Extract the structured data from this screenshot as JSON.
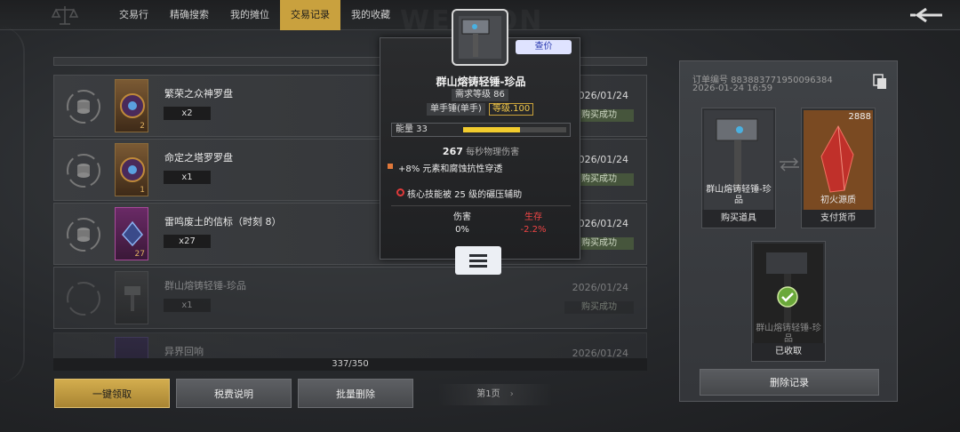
{
  "nav": {
    "tabs": [
      {
        "label": "交易行",
        "active": false
      },
      {
        "label": "精确搜索",
        "active": false
      },
      {
        "label": "我的摊位",
        "active": false
      },
      {
        "label": "交易记录",
        "active": true
      },
      {
        "label": "我的收藏",
        "active": false
      }
    ],
    "watermark": "WEAPON",
    "back_icon": "back-arrow-icon"
  },
  "list": {
    "rows": [
      {
        "name": "繁荣之众神罗盘",
        "qty": "x2",
        "count": "2",
        "date": "2026/01/24",
        "status": "购买成功",
        "thumb_color": "#8a6a3a",
        "icon": "coin-cycle-icon",
        "dim": false
      },
      {
        "name": "命定之塔罗罗盘",
        "qty": "x1",
        "count": "1",
        "date": "2026/01/24",
        "status": "购买成功",
        "thumb_color": "#8a6a3a",
        "icon": "coin-cycle-icon",
        "dim": false
      },
      {
        "name": "雷鸣废土的信标（时刻 8）",
        "qty": "x27",
        "count": "27",
        "date": "2026/01/24",
        "status": "购买成功",
        "thumb_color": "#a84a9a",
        "icon": "coin-cycle-icon",
        "dim": false
      },
      {
        "name": "群山熔铸轻锤-珍品",
        "qty": "x1",
        "count": "",
        "date": "2026/01/24",
        "status": "购买成功",
        "thumb_color": "#666666",
        "icon": "coin-cycle-icon",
        "dim": true
      },
      {
        "name": "异界回响",
        "qty": "",
        "count": "",
        "date": "2026/01/24",
        "status": "",
        "thumb_color": "#5a4a8a",
        "icon": "coin-cycle-icon",
        "dim": true
      }
    ],
    "pager": "337/350"
  },
  "buttons": {
    "claim_all": "一键领取",
    "tax_info": "税费说明",
    "batch_delete": "批量删除",
    "page": "第1页"
  },
  "detail": {
    "order_no": "订单编号 883883771950096384",
    "order_time": "2026-01-24 16:59",
    "bought_item": {
      "name": "群山熔铸轻锤-珍品",
      "caption": "购买道具"
    },
    "payment": {
      "name": "初火源质",
      "caption": "支付货币",
      "amount": "2888"
    },
    "received": {
      "name": "群山熔铸轻锤-珍品",
      "caption": "已收取"
    },
    "delete_label": "删除记录"
  },
  "tooltip": {
    "title": "群山熔铸轻锤-珍品",
    "check_price": "查价",
    "req_level": "需求等级 86",
    "weapon_type": "单手锤(单手)",
    "item_level": "等级.100",
    "energy_label": "能量 33",
    "energy_fill": 0.55,
    "damage_value": "267",
    "damage_label": "每秒物理伤害",
    "affix1": "+8% 元素和腐蚀抗性穿透",
    "affix2": "核心技能被 25 级的碾压辅助",
    "stat_left_label": "伤害",
    "stat_left_value": "0%",
    "stat_right_label": "生存",
    "stat_right_value": "-2.2%"
  },
  "colors": {
    "accent_gold": "#c9a13e",
    "status_green": "#46553c",
    "negative_red": "#f04545",
    "energy_yellow": "#f2cc2e"
  }
}
